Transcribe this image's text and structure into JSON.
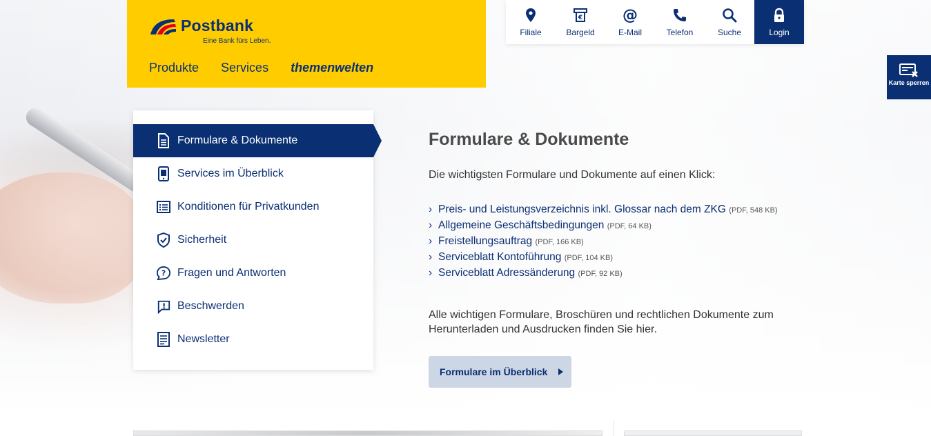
{
  "brand": {
    "name": "Postbank",
    "tagline": "Eine Bank fürs Leben."
  },
  "main_nav": [
    {
      "label": "Produkte"
    },
    {
      "label": "Services"
    },
    {
      "label": "themenwelten"
    }
  ],
  "utility_nav": [
    {
      "label": "Filiale",
      "icon": "location-pin-icon"
    },
    {
      "label": "Bargeld",
      "icon": "cash-icon"
    },
    {
      "label": "E-Mail",
      "icon": "at-icon"
    },
    {
      "label": "Telefon",
      "icon": "phone-icon"
    },
    {
      "label": "Suche",
      "icon": "search-icon"
    },
    {
      "label": "Login",
      "icon": "lock-icon"
    }
  ],
  "side_tab": {
    "label": "Karte sperren",
    "icon": "card-block-icon"
  },
  "side_menu": [
    {
      "label": "Formulare & Dokumente",
      "icon": "document-icon",
      "active": true
    },
    {
      "label": "Services im Überblick",
      "icon": "tablet-icon"
    },
    {
      "label": "Konditionen für Privatkunden",
      "icon": "list-icon"
    },
    {
      "label": "Sicherheit",
      "icon": "shield-icon"
    },
    {
      "label": "Fragen und Antworten",
      "icon": "question-icon"
    },
    {
      "label": "Beschwerden",
      "icon": "complaint-icon"
    },
    {
      "label": "Newsletter",
      "icon": "newsletter-icon"
    }
  ],
  "content": {
    "title": "Formulare & Dokumente",
    "intro": "Die wichtigsten Formulare und Dokumente auf einen Klick:",
    "documents": [
      {
        "label": "Preis- und Leistungsverzeichnis inkl. Glossar nach dem ZKG",
        "meta": "(PDF, 548 KB)"
      },
      {
        "label": "Allgemeine Geschäftsbedingungen",
        "meta": "(PDF, 64 KB)"
      },
      {
        "label": "Freistellungsauftrag",
        "meta": "(PDF, 166 KB)"
      },
      {
        "label": "Serviceblatt Kontoführung",
        "meta": "(PDF, 104 KB)"
      },
      {
        "label": "Serviceblatt Adressänderung",
        "meta": "(PDF, 92 KB)"
      }
    ],
    "outro": "Alle wichtigen Formulare, Broschüren und rechtlichen Dokumente zum Herunterladen und Ausdrucken finden Sie hier.",
    "cta_label": "Formulare im Überblick"
  },
  "colors": {
    "brand_yellow": "#ffcc00",
    "brand_blue": "#0a2f73",
    "cta_bg": "#cdd6e4"
  }
}
